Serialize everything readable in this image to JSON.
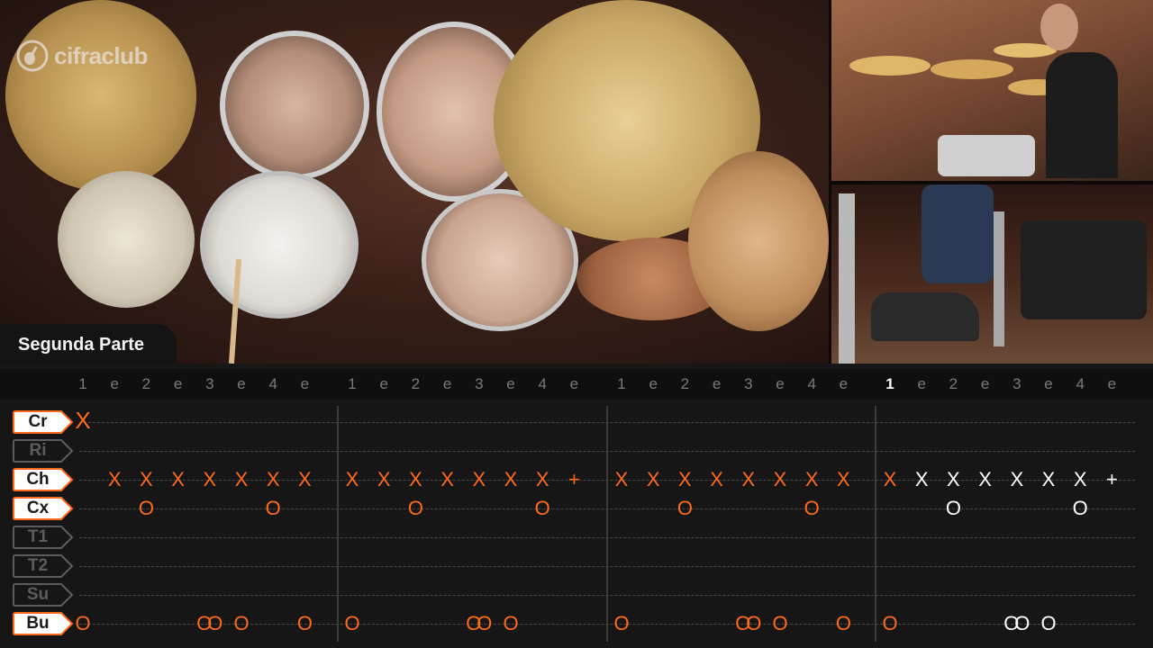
{
  "video": {
    "logo_text": "cifraclub",
    "section_label": "Segunda Parte"
  },
  "counts": [
    "1",
    "e",
    "2",
    "e",
    "3",
    "e",
    "4",
    "e"
  ],
  "active_measure": 3,
  "colors": {
    "accent": "#ff6a1a",
    "current": "#ffffff",
    "inactive": "#5c5c5c"
  },
  "lanes": [
    {
      "label": "Cr",
      "active": true
    },
    {
      "label": "Ri",
      "active": false
    },
    {
      "label": "Ch",
      "active": true
    },
    {
      "label": "Cx",
      "active": true
    },
    {
      "label": "T1",
      "active": false
    },
    {
      "label": "T2",
      "active": false
    },
    {
      "label": "Su",
      "active": false
    },
    {
      "label": "Bu",
      "active": true
    }
  ],
  "measures": [
    {
      "Cr": [
        [
          "X",
          0
        ]
      ],
      "Ch": [
        [
          "X",
          1
        ],
        [
          "X",
          2
        ],
        [
          "X",
          3
        ],
        [
          "X",
          4
        ],
        [
          "X",
          5
        ],
        [
          "X",
          6
        ],
        [
          "X",
          7
        ]
      ],
      "Cx": [
        [
          "O",
          2
        ],
        [
          "O",
          6
        ]
      ],
      "Bu": [
        [
          "O",
          0
        ],
        [
          "O",
          3.83
        ],
        [
          "O",
          4.17
        ],
        [
          "O",
          5
        ],
        [
          "O",
          7
        ]
      ]
    },
    {
      "Cr": [],
      "Ch": [
        [
          "X",
          0
        ],
        [
          "X",
          1
        ],
        [
          "X",
          2
        ],
        [
          "X",
          3
        ],
        [
          "X",
          4
        ],
        [
          "X",
          5
        ],
        [
          "X",
          6
        ],
        [
          "+",
          7
        ]
      ],
      "Cx": [
        [
          "O",
          2
        ],
        [
          "O",
          6
        ]
      ],
      "Bu": [
        [
          "O",
          0
        ],
        [
          "O",
          3.83
        ],
        [
          "O",
          4.17
        ],
        [
          "O",
          5
        ]
      ]
    },
    {
      "Cr": [],
      "Ch": [
        [
          "X",
          0
        ],
        [
          "X",
          1
        ],
        [
          "X",
          2
        ],
        [
          "X",
          3
        ],
        [
          "X",
          4
        ],
        [
          "X",
          5
        ],
        [
          "X",
          6
        ],
        [
          "X",
          7
        ]
      ],
      "Cx": [
        [
          "O",
          2
        ],
        [
          "O",
          6
        ]
      ],
      "Bu": [
        [
          "O",
          0
        ],
        [
          "O",
          3.83
        ],
        [
          "O",
          4.17
        ],
        [
          "O",
          5
        ],
        [
          "O",
          7
        ]
      ]
    },
    {
      "Cr": [],
      "Ch": [
        [
          "X",
          0
        ],
        [
          "X",
          1
        ],
        [
          "X",
          2
        ],
        [
          "X",
          3
        ],
        [
          "X",
          4
        ],
        [
          "X",
          5
        ],
        [
          "X",
          6
        ],
        [
          "+",
          7
        ]
      ],
      "Cx": [
        [
          "O",
          2
        ],
        [
          "O",
          6
        ]
      ],
      "Bu": [
        [
          "O",
          0
        ],
        [
          "O",
          3.83
        ],
        [
          "O",
          4.17
        ],
        [
          "O",
          5
        ]
      ]
    }
  ]
}
